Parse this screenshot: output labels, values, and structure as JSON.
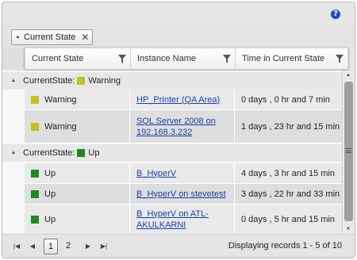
{
  "colors": {
    "warning": "#c2c21a",
    "up": "#1f8a1f",
    "help": "#1d4fb8",
    "link": "#1a3fa6"
  },
  "group_panel": {
    "chip_label": "Current State",
    "chip_sort_icon": "sort-ascending-icon",
    "chip_remove_icon": "close-icon"
  },
  "columns": [
    {
      "label": "Current State",
      "icon": "filter-icon"
    },
    {
      "label": "Instance Name",
      "icon": "filter-icon"
    },
    {
      "label": "Time in Current State",
      "icon": "filter-icon"
    }
  ],
  "groups": [
    {
      "label": "CurrentState:",
      "state": "Warning",
      "rows": [
        {
          "state": "Warning",
          "instance": "HP_Printer (QA Area)",
          "time": "0 days , 0 hr and 7 min"
        },
        {
          "state": "Warning",
          "instance": "SQL Server 2008 on 192.168.3.232",
          "time": "1 days , 23 hr and 15 min"
        }
      ]
    },
    {
      "label": "CurrentState:",
      "state": "Up",
      "rows": [
        {
          "state": "Up",
          "instance": "B_HyperV",
          "time": "4 days , 3 hr and 15 min"
        },
        {
          "state": "Up",
          "instance": "B_HyperV on stevetest",
          "time": "3 days , 22 hr and 33 min"
        },
        {
          "state": "Up",
          "instance": "B_HyperV on ATL-AKULKARNI",
          "time": "0 days , 5 hr and 15 min"
        }
      ]
    }
  ],
  "pager": {
    "pages": [
      "1",
      "2"
    ],
    "current_page": "1",
    "info": "Displaying records 1 - 5 of 10"
  }
}
